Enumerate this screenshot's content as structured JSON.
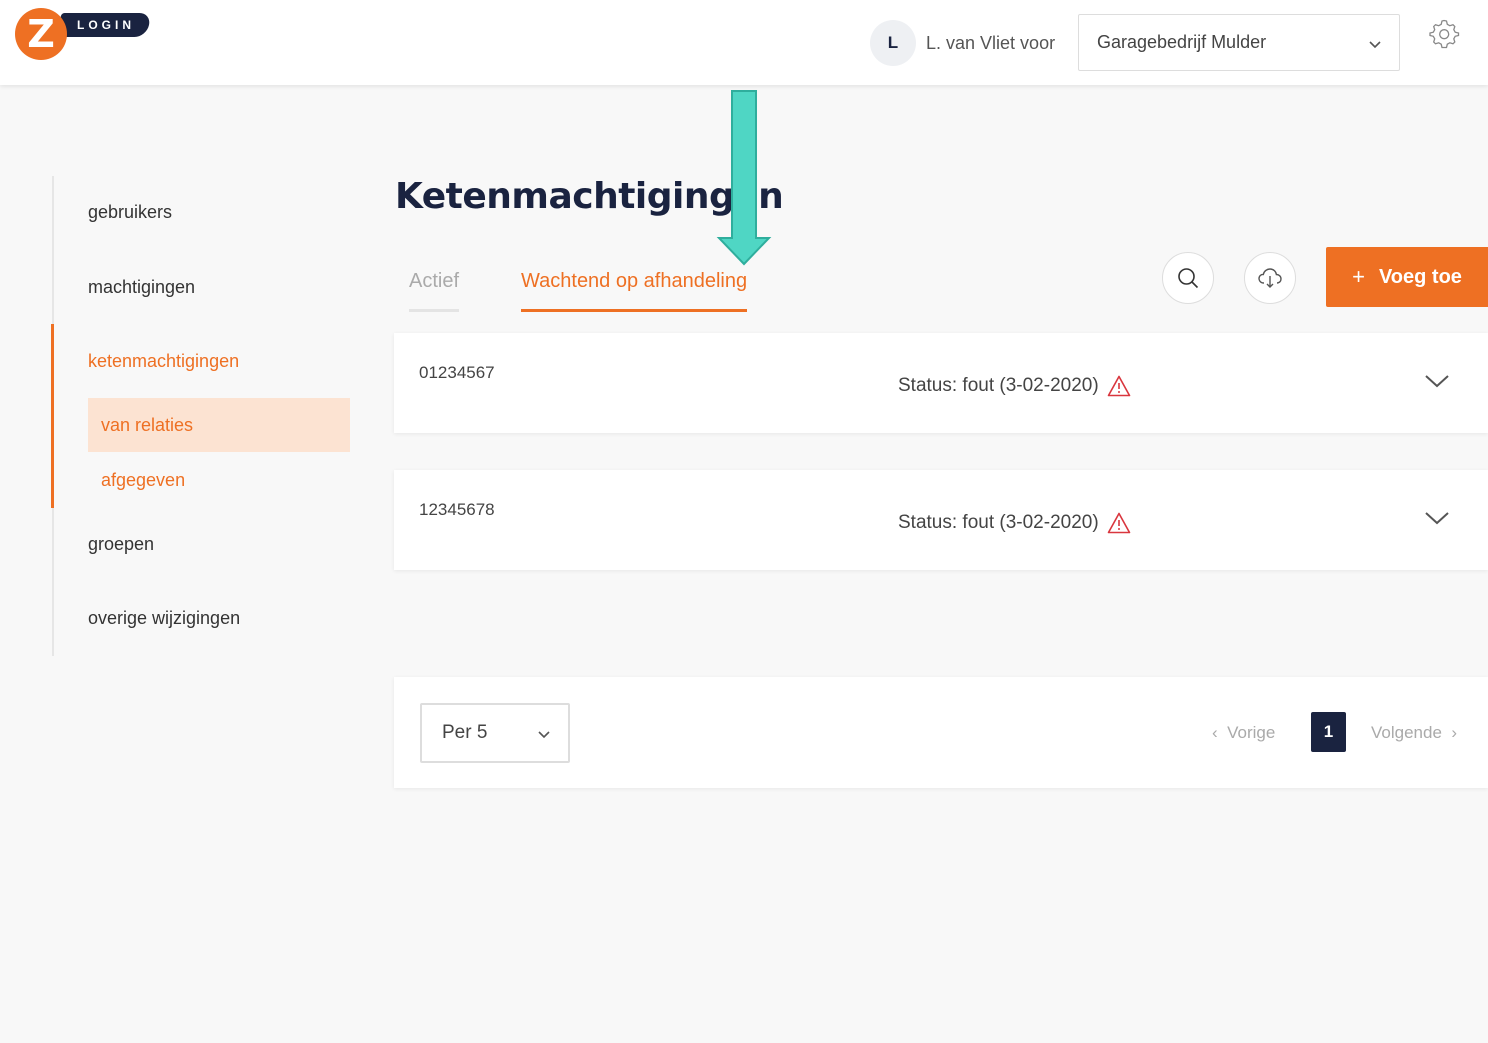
{
  "app": {
    "logo_letter": "Z",
    "logo_text": "LOGIN",
    "brand_color": "#ee7023",
    "navy_color": "#1a2340"
  },
  "header": {
    "avatar_initial": "L",
    "user_text": "L. van Vliet voor",
    "org_selected": "Garagebedrijf Mulder"
  },
  "sidebar": {
    "items": [
      {
        "label": "gebruikers"
      },
      {
        "label": "machtigingen"
      },
      {
        "label": "ketenmachtigingen"
      },
      {
        "label": "groepen"
      },
      {
        "label": "overige wijzigingen"
      }
    ],
    "subitems": [
      {
        "label": "van relaties"
      },
      {
        "label": "afgegeven"
      }
    ]
  },
  "main": {
    "title": "Ketenmachtigingen",
    "tabs": [
      {
        "label": "Actief"
      },
      {
        "label": "Wachtend op afhandeling"
      }
    ],
    "add_button": {
      "plus": "+",
      "label": "Voeg toe"
    },
    "rows": [
      {
        "number": "01234567",
        "status": "Status: fout (3-02-2020)"
      },
      {
        "number": "12345678",
        "status": "Status: fout (3-02-2020)"
      }
    ],
    "pagination": {
      "per_page": "Per 5",
      "prev": "Vorige",
      "current": "1",
      "next": "Volgende"
    }
  },
  "annotation": {
    "arrow_color": "#4fd6c4"
  }
}
